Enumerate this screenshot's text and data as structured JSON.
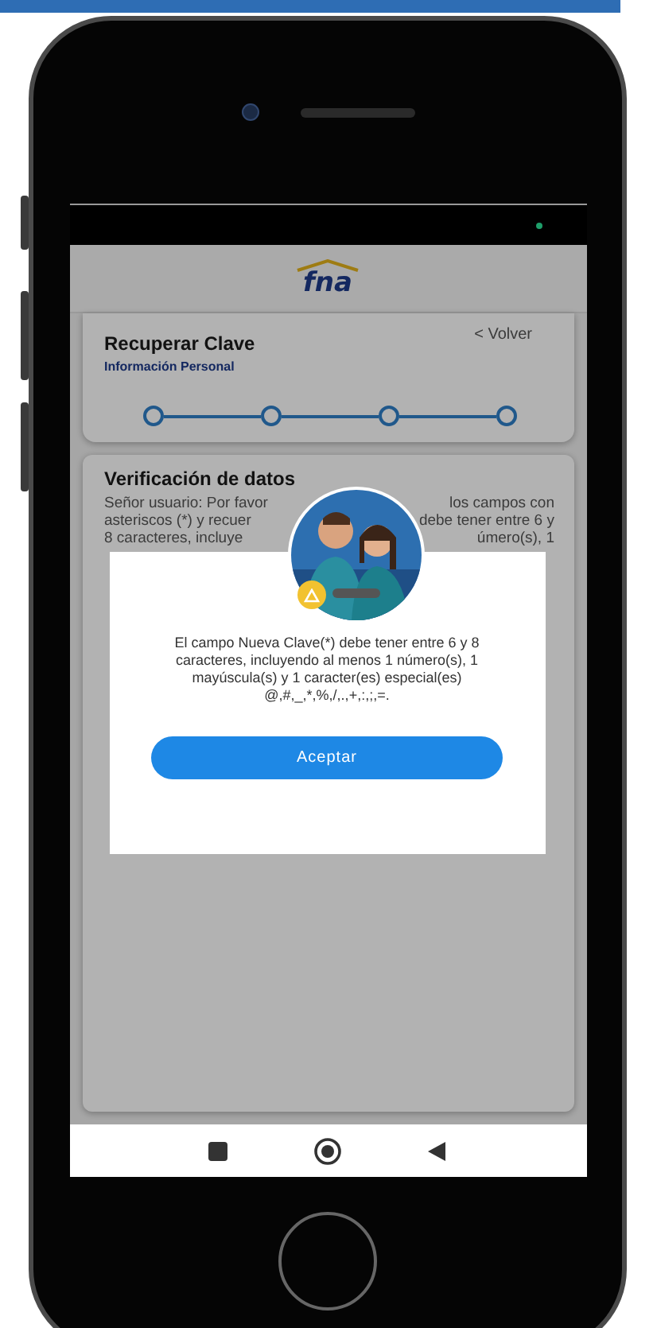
{
  "page": {
    "title": "Recuperar Clave",
    "subtitle": "Información Personal",
    "back_link": "< Volver"
  },
  "header": {
    "logo": "fna"
  },
  "steps": [
    {
      "done": false
    },
    {
      "done": false
    },
    {
      "done": false
    },
    {
      "done": false
    }
  ],
  "section": {
    "title": "Verificación de datos",
    "lines": [
      [
        "Señor usuario: Por favor",
        "los campos con"
      ],
      [
        "asteriscos (*) y recuer",
        "debe tener entre 6 y"
      ],
      [
        "8 caracteres, incluye",
        "úmero(s), 1"
      ]
    ]
  },
  "dialog": {
    "message": "El campo Nueva Clave(*) debe tener entre 6 y 8 caracteres, incluyendo al menos 1 número(s), 1 mayúscula(s) y 1 caracter(es) especial(es) @,#,_,*,%,/,.,+,:,;,=.",
    "button": "Aceptar"
  },
  "nav_bar": [
    {
      "kind": "square"
    },
    {
      "kind": "circle"
    },
    {
      "kind": "triangle"
    }
  ]
}
